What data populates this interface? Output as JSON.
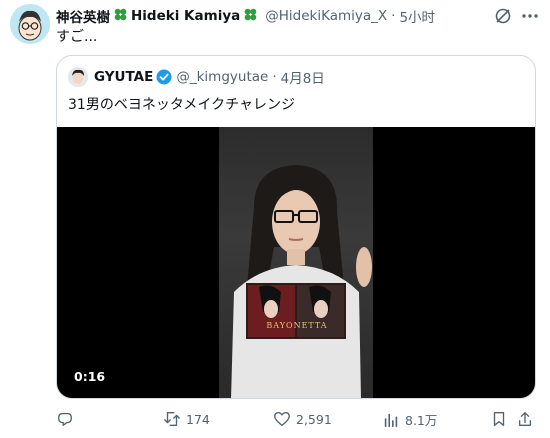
{
  "tweet": {
    "display_name": "神谷英樹",
    "display_name_latin": "Hideki Kamiya",
    "clover": "🍀",
    "handle": "@HidekiKamiya_X",
    "separator": "·",
    "time": "5小时",
    "text": "すご..."
  },
  "quoted": {
    "display_name": "GYUTAE",
    "handle": "@_kimgyutae",
    "separator": "·",
    "date": "4月8日",
    "text": "31男のベヨネッタメイクチャレンジ",
    "video_duration": "0:16",
    "shirt_logo_text": "BAYONETTA"
  },
  "actions": {
    "replies": "",
    "retweets": "174",
    "likes": "2,591",
    "views": "8.1万"
  },
  "colors": {
    "text": "#0f1419",
    "muted": "#536471",
    "verified": "#1d9bf0",
    "clover": "#2e9e3e"
  }
}
